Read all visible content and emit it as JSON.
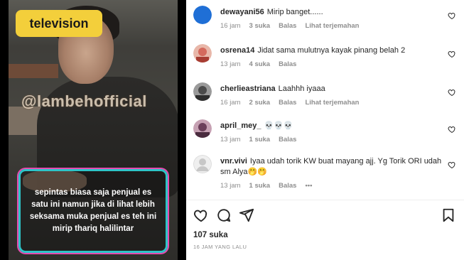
{
  "media": {
    "badge": "television",
    "watermark": "@lambehofficial",
    "caption": "sepintas biasa saja penjual es satu ini namun jika di lihat lebih seksama muka penjual es teh ini mirip thariq halilintar"
  },
  "comments": [
    {
      "username": "dewayani56",
      "text": "Mirip banget......",
      "time": "16 jam",
      "likes": "3 suka",
      "reply": "Balas",
      "translate": "Lihat terjemahan",
      "avatar_color": "#1f6fd6"
    },
    {
      "username": "osrena14",
      "text": "Jidat sama mulutnya kayak pinang belah 2",
      "time": "13 jam",
      "likes": "4 suka",
      "reply": "Balas",
      "translate": "",
      "avatar_color": "#d46a5d"
    },
    {
      "username": "cherlieastriana",
      "text": "Laahhh iyaaa",
      "time": "16 jam",
      "likes": "2 suka",
      "reply": "Balas",
      "translate": "Lihat terjemahan",
      "avatar_color": "#4b4b4b"
    },
    {
      "username": "april_mey_",
      "text": "💀💀💀",
      "time": "13 jam",
      "likes": "1 suka",
      "reply": "Balas",
      "translate": "",
      "avatar_color": "#6b3f5a"
    },
    {
      "username": "vnr.vivi",
      "text": "Iyaa udah torik KW buat mayang ajj. Yg Torik ORI udah sm Alya🤭🤭",
      "time": "13 jam",
      "likes": "1 suka",
      "reply": "Balas",
      "translate": "",
      "more": "•••",
      "avatar_color": "#dbdbdb"
    }
  ],
  "footer": {
    "likes": "107 suka",
    "time": "16 JAM YANG LALU"
  },
  "colors": {
    "text": "#262626",
    "meta": "#8e8e8e"
  }
}
